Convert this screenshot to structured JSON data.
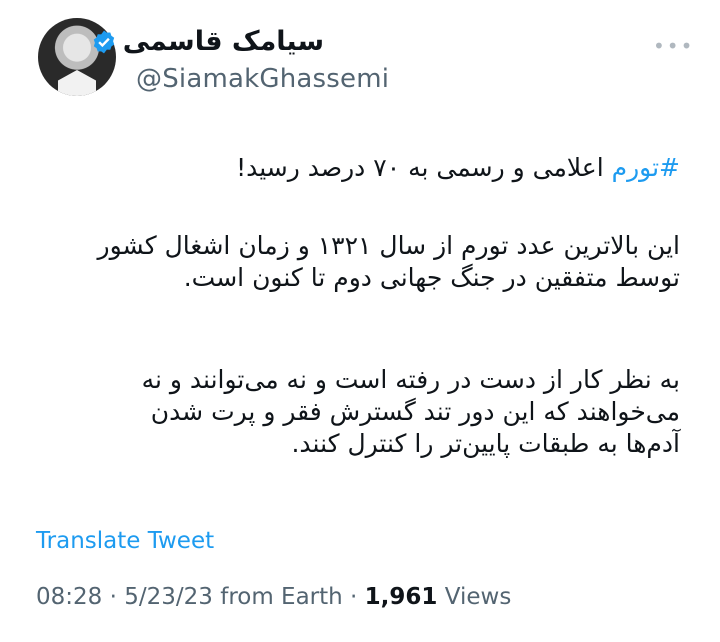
{
  "author": {
    "display_name": "سیامک قاسمی",
    "handle": "@SiamakGhassemi",
    "verified_icon": "verified-badge-icon"
  },
  "more_icon": "more-options-icon",
  "tweet": {
    "hashtag": "#تورم",
    "line1_rest": " اعلامی و رسمی به ۷۰ درصد رسید!",
    "paragraph2_line1": "این بالاترین عدد تورم از سال ۱۳۲۱ و زمان اشغال کشور",
    "paragraph2_line2": "توسط متفقین در جنگ جهانی دوم تا کنون است.",
    "paragraph3_line1": "به نظر کار از دست در رفته است و نه می‌توانند و نه",
    "paragraph3_line2": "می‌خواهند که این دور تند گسترش فقر و پرت شدن",
    "paragraph3_line3": "آدم‌ها به طبقات پایین‌تر را کنترل کنند."
  },
  "translate_label": "Translate Tweet",
  "meta": {
    "time": "08:28",
    "date": "5/23/23",
    "source": "from Earth",
    "views_count": "1,961",
    "views_label": "Views"
  },
  "colors": {
    "link": "#1d9bf0",
    "secondary": "#536471",
    "text": "#0f1419"
  }
}
